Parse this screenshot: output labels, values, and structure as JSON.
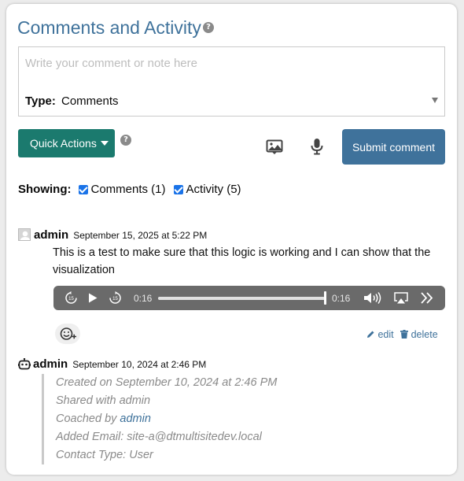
{
  "header": {
    "title": "Comments and Activity",
    "help": "?"
  },
  "composer": {
    "placeholder": "Write your comment or note here",
    "type_label": "Type:",
    "type_value": "Comments"
  },
  "toolbar": {
    "quick_actions_label": "Quick Actions",
    "help": "?",
    "image_icon": "image-icon",
    "mic_icon": "microphone-icon",
    "submit_label": "Submit comment"
  },
  "filters": {
    "label": "Showing:",
    "comments_label": "Comments (1)",
    "activity_label": "Activity (5)"
  },
  "comment": {
    "author": "admin",
    "date": "September 15, 2025 at 5:22 PM",
    "text": "This is a test to make sure that this logic is working and I can show that the visualization",
    "audio": {
      "current_time": "0:16",
      "duration": "0:16",
      "progress": 1.0,
      "skip_seconds": "15"
    },
    "edit_label": "edit",
    "delete_label": "delete"
  },
  "activity": {
    "author": "admin",
    "date": "September 10, 2024 at 2:46 PM",
    "lines": {
      "created": "Created on September 10, 2024 at 2:46 PM",
      "shared": "Shared with admin",
      "coached_prefix": "Coached by ",
      "coached_link": "admin",
      "email": "Added Email: site-a@dtmultisitedev.local",
      "contact_type": "Contact Type: User"
    }
  },
  "colors": {
    "title": "#3f729b",
    "quick_actions_bg": "#1b7a6e",
    "submit_bg": "#3f729b",
    "link": "#3f729b",
    "checkbox": "#1a73e8"
  }
}
